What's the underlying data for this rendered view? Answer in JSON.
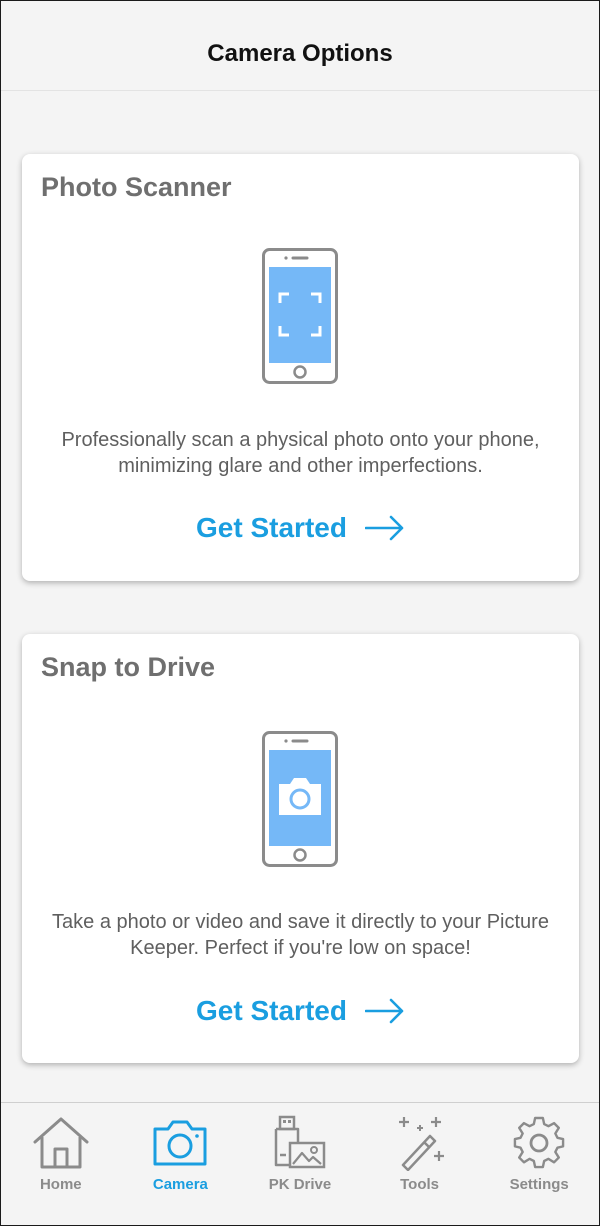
{
  "header": {
    "title": "Camera Options"
  },
  "cards": [
    {
      "title": "Photo Scanner",
      "icon": "phone-scan-icon",
      "description": "Professionally scan a physical photo onto your phone, minimizing glare and other imperfections.",
      "cta": "Get Started"
    },
    {
      "title": "Snap to Drive",
      "icon": "phone-camera-icon",
      "description": "Take a photo or video and save it directly to your Picture Keeper. Perfect if you're low on space!",
      "cta": "Get Started"
    }
  ],
  "tabs": [
    {
      "label": "Home",
      "icon": "home-icon",
      "active": false
    },
    {
      "label": "Camera",
      "icon": "camera-icon",
      "active": true
    },
    {
      "label": "PK Drive",
      "icon": "usb-drive-photo-icon",
      "active": false
    },
    {
      "label": "Tools",
      "icon": "magic-wand-icon",
      "active": false
    },
    {
      "label": "Settings",
      "icon": "gear-icon",
      "active": false
    }
  ],
  "colors": {
    "accent": "#1a9ee0",
    "screen": "#75b8f7",
    "icon_gray": "#8b8b8b",
    "title_gray": "#6f6f6f"
  }
}
